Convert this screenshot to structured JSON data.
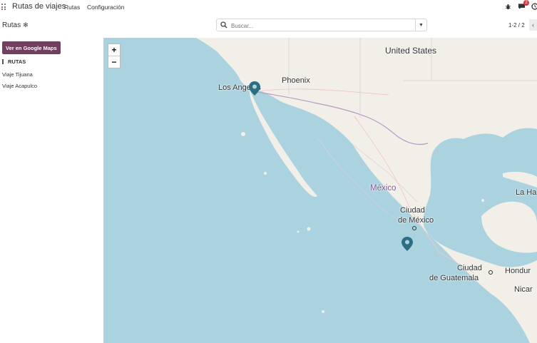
{
  "topbar": {
    "app_name": "Rutas de viajes",
    "menu": [
      "Rutas",
      "Configuración"
    ],
    "icons": [
      "apps-grid-icon",
      "bug-icon",
      "chat-icon",
      "clock-icon"
    ],
    "chat_badge": "2",
    "accent": "#71405e"
  },
  "control_panel": {
    "breadcrumb": "Rutas",
    "search_placeholder": "Buscar...",
    "pager": "1-2 / 2"
  },
  "sidebar": {
    "google_maps_button": "Ver en Google Maps",
    "section_title": "RUTAS",
    "routes": [
      "Viaje Tijuana",
      "Viaje Acapulco"
    ]
  },
  "map": {
    "zoom_in": "+",
    "zoom_out": "−",
    "labels": {
      "united_states": "United States",
      "los_angeles": "Los Angeles",
      "phoenix": "Phoenix",
      "mexico": "México",
      "ciudad_mexico_1": "Ciudad",
      "ciudad_mexico_2": "de México",
      "ciudad_guatemala_1": "Ciudad",
      "ciudad_guatemala_2": "de Guatemala",
      "honduras": "Hondur",
      "nicaragua": "Nicar",
      "la_habana": "La Ha"
    },
    "colors": {
      "water": "#aad3df",
      "land": "#f2efe9",
      "marker": "#2e6e83"
    }
  }
}
